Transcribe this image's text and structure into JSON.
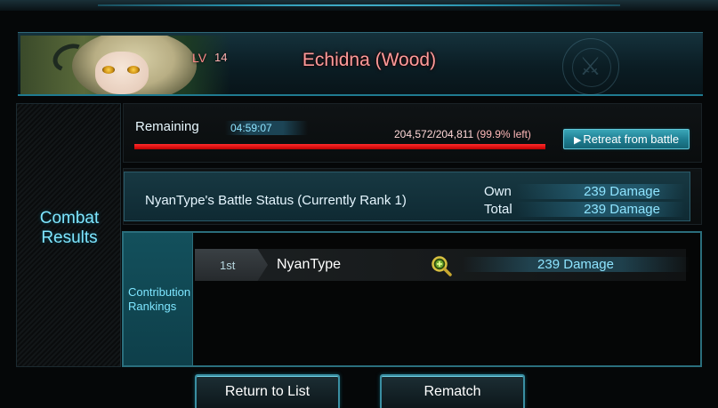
{
  "boss": {
    "level_label": "LV",
    "level": "14",
    "name": "Echidna (Wood)"
  },
  "sidebar": {
    "title_line1": "Combat",
    "title_line2": "Results"
  },
  "remaining": {
    "label": "Remaining",
    "timer": "04:59:07",
    "hp_text": "204,572/204,811",
    "hp_percent_text": "(99.9% left)",
    "hp_fraction": 0.999,
    "retreat_label": "Retreat from battle"
  },
  "battle_status": {
    "title": "NyanType's Battle Status (Currently Rank 1)",
    "own_label": "Own",
    "own_value": "239 Damage",
    "total_label": "Total",
    "total_value": "239 Damage"
  },
  "rankings": {
    "label_line1": "Contribution",
    "label_line2": "Rankings",
    "rows": [
      {
        "position": "1st",
        "name": "NyanType",
        "damage": "239 Damage"
      }
    ]
  },
  "buttons": {
    "return_label": "Return to List",
    "rematch_label": "Rematch"
  },
  "colors": {
    "accent": "#7ee6ff",
    "hp_bar": "#d40000",
    "boss_name": "#ff9a9a"
  }
}
